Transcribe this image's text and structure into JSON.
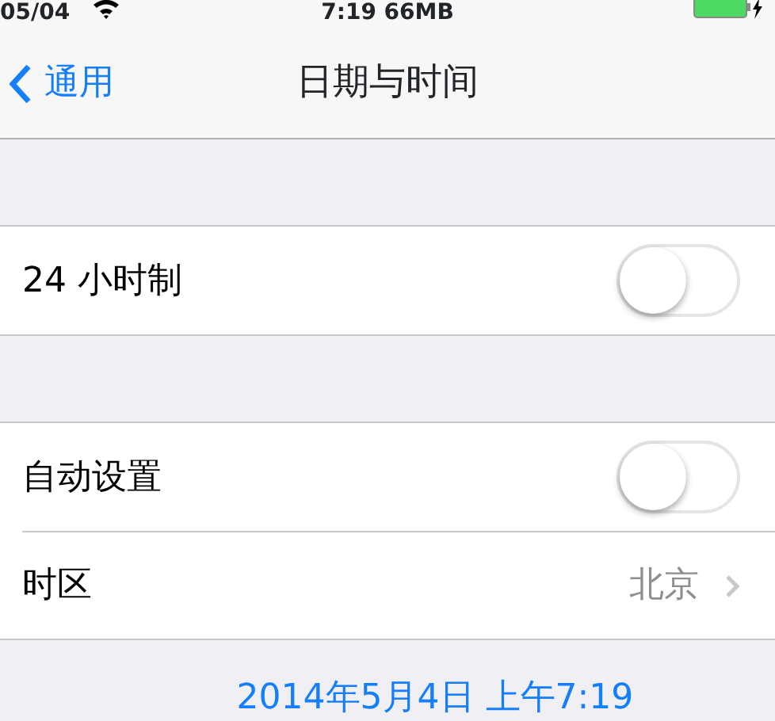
{
  "status_bar": {
    "date": "05/04",
    "center": "7:19 66MB"
  },
  "nav_bar": {
    "back": "通用",
    "title": "日期与时间"
  },
  "sections": [
    {
      "rows": [
        {
          "kind": "toggle",
          "label": "24 小时制",
          "on": false
        }
      ]
    },
    {
      "rows": [
        {
          "kind": "toggle",
          "label": "自动设置",
          "on": false
        },
        {
          "kind": "detail",
          "label": "时区",
          "value": "北京"
        }
      ]
    }
  ],
  "current_time": "2014年5月4日 上午7:19"
}
